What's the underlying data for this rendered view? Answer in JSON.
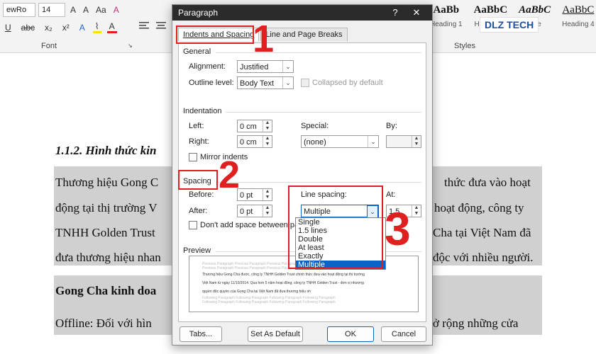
{
  "ribbon": {
    "font_name": "ewRo",
    "font_size": "14",
    "grow_font": "A",
    "shrink_font": "A",
    "change_case": "Aa",
    "clear_format": "A",
    "underline": "U",
    "strike": "abc",
    "subscript": "x₂",
    "superscript": "x²",
    "text_effect": "A",
    "highlight": "⌇",
    "font_color": "A",
    "font_group_label": "Font",
    "styles_group_label": "Styles",
    "styles": [
      {
        "preview": "AaBb",
        "name": "Heading 1"
      },
      {
        "preview": "AaBbC",
        "name": "Heading 2"
      },
      {
        "preview": "AaBbC",
        "name": "Title"
      },
      {
        "preview": "AaBbC",
        "name": "Heading 4"
      }
    ],
    "logo_text": "DLZ TECH"
  },
  "document": {
    "heading": "1.1.2. Hình thức kin",
    "lines": [
      "Thương hiệu Gong C",
      "động tại thị trường V",
      "TNHH Golden Trust",
      "đưa thương hiệu nhan"
    ],
    "lines_right": [
      "thức đưa vào hoạt",
      "hoạt động, công ty",
      "Cha tại Việt Nam đã",
      "độc với nhiều người."
    ],
    "subheading": "Gong Cha kinh doa",
    "offline_left": "Offline: Đối với hìn",
    "offline_right": "ở rộng những cửa"
  },
  "dialog": {
    "title": "Paragraph",
    "help": "?",
    "close": "✕",
    "tabs": [
      "Indents and Spacing",
      "Line and Page Breaks"
    ],
    "general": {
      "label": "General",
      "alignment_label": "Alignment:",
      "alignment_value": "Justified",
      "outline_label": "Outline level:",
      "outline_value": "Body Text",
      "collapsed_label": "Collapsed by default"
    },
    "indentation": {
      "label": "Indentation",
      "left_label": "Left:",
      "left_value": "0 cm",
      "right_label": "Right:",
      "right_value": "0 cm",
      "special_label": "Special:",
      "special_value": "(none)",
      "by_label": "By:",
      "by_value": "",
      "mirror_label": "Mirror indents"
    },
    "spacing": {
      "label": "Spacing",
      "before_label": "Before:",
      "before_value": "0 pt",
      "after_label": "After:",
      "after_value": "0 pt",
      "line_spacing_label": "Line spacing:",
      "line_spacing_value": "Multiple",
      "at_label": "At:",
      "at_value": "1.5",
      "dont_add_label": "Don't add space between para",
      "options": [
        "Single",
        "1.5 lines",
        "Double",
        "At least",
        "Exactly",
        "Multiple"
      ],
      "selected_index": 5
    },
    "preview": {
      "label": "Preview",
      "previous": "Previous Paragraph Previous Paragraph Previous Paragraph Previous Paragraph Previous Paragraph",
      "current": [
        "Thương hiệu Gong Cha được, công ty TNHH Golden Trust chính thức đưa vào hoạt động tại thị trường",
        "Việt Nam từ ngày 11/10/2014. Qua hơn 5 năm hoạt động, công ty TNHH Golden Trust - đơn vị nhượng",
        "quyền độc quyền của Gong Cha tại Việt Nam đã đưa thương hiệu nh"
      ],
      "following": "Following Paragraph Following Paragraph Following Paragraph Following Paragraph"
    },
    "buttons": {
      "tabs": "Tabs...",
      "set_default": "Set As Default",
      "ok": "OK",
      "cancel": "Cancel"
    }
  },
  "annotations": [
    "1",
    "2",
    "3"
  ],
  "colors": {
    "annotation": "#e02020",
    "selection": "#0a64c8",
    "titlebar": "#2b2b2b"
  }
}
